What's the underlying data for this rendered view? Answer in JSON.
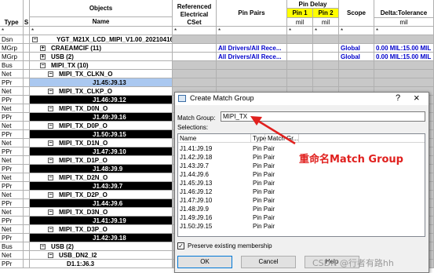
{
  "columns": {
    "type": "Type",
    "s": "S",
    "objects": "Objects",
    "name": "Name",
    "referenced_cset": "Referenced Electrical CSet",
    "pin_pairs": "Pin Pairs",
    "pin_delay": "Pin Delay",
    "pin1": "Pin 1",
    "pin2": "Pin 2",
    "mil1": "mil",
    "mil2": "mil",
    "scope": "Scope",
    "delta_tolerance": "Delta:Tolerance",
    "delta_unit": "mil",
    "star": "*"
  },
  "rows": [
    {
      "type": "Dsn",
      "name": "YGT_M21X_LCD_MIPI_V1.00_20210416-17",
      "toggle": "−",
      "indent": 0,
      "style": "bold",
      "pin_pairs": "",
      "scope": "",
      "delta": ""
    },
    {
      "type": "MGrp",
      "name": "CRAEAMCIF (11)",
      "toggle": "+",
      "indent": 1,
      "style": "bold",
      "pin_pairs": "All Drivers/All Rece...",
      "scope": "Global",
      "delta": "0.00 MIL:15.00 MIL"
    },
    {
      "type": "MGrp",
      "name": "USB (2)",
      "toggle": "+",
      "indent": 1,
      "style": "bold",
      "pin_pairs": "All Drivers/All Rece...",
      "scope": "Global",
      "delta": "0.00 MIL:15.00 MIL"
    },
    {
      "type": "Bus",
      "name": "MIPI_TX (10)",
      "toggle": "−",
      "indent": 1,
      "style": "bold",
      "pin_pairs": "",
      "scope": "",
      "delta": ""
    },
    {
      "type": "Net",
      "name": "MIPI_TX_CLKN_O",
      "toggle": "−",
      "indent": 2,
      "style": "bold",
      "pin_pairs": "",
      "scope": "",
      "delta": ""
    },
    {
      "type": "PPr",
      "name": "J1.45:J9.13",
      "toggle": "",
      "indent": 3,
      "style": "selected",
      "pin_pairs": "",
      "scope": "",
      "delta": ""
    },
    {
      "type": "Net",
      "name": "MIPI_TX_CLKP_O",
      "toggle": "−",
      "indent": 2,
      "style": "bold",
      "pin_pairs": "",
      "scope": "",
      "delta": ""
    },
    {
      "type": "PPr",
      "name": "J1.46:J9.12",
      "toggle": "",
      "indent": 3,
      "style": "dark",
      "pin_pairs": "",
      "scope": "",
      "delta": ""
    },
    {
      "type": "Net",
      "name": "MIPI_TX_D0N_O",
      "toggle": "−",
      "indent": 2,
      "style": "bold",
      "pin_pairs": "",
      "scope": "",
      "delta": ""
    },
    {
      "type": "PPr",
      "name": "J1.49:J9.16",
      "toggle": "",
      "indent": 3,
      "style": "dark",
      "pin_pairs": "",
      "scope": "",
      "delta": ""
    },
    {
      "type": "Net",
      "name": "MIPI_TX_D0P_O",
      "toggle": "−",
      "indent": 2,
      "style": "bold",
      "pin_pairs": "",
      "scope": "",
      "delta": ""
    },
    {
      "type": "PPr",
      "name": "J1.50:J9.15",
      "toggle": "",
      "indent": 3,
      "style": "dark",
      "pin_pairs": "",
      "scope": "",
      "delta": ""
    },
    {
      "type": "Net",
      "name": "MIPI_TX_D1N_O",
      "toggle": "−",
      "indent": 2,
      "style": "bold",
      "pin_pairs": "",
      "scope": "",
      "delta": ""
    },
    {
      "type": "PPr",
      "name": "J1.47:J9.10",
      "toggle": "",
      "indent": 3,
      "style": "dark",
      "pin_pairs": "",
      "scope": "",
      "delta": ""
    },
    {
      "type": "Net",
      "name": "MIPI_TX_D1P_O",
      "toggle": "−",
      "indent": 2,
      "style": "bold",
      "pin_pairs": "",
      "scope": "",
      "delta": ""
    },
    {
      "type": "PPr",
      "name": "J1.48:J9.9",
      "toggle": "",
      "indent": 3,
      "style": "dark",
      "pin_pairs": "",
      "scope": "",
      "delta": ""
    },
    {
      "type": "Net",
      "name": "MIPI_TX_D2N_O",
      "toggle": "−",
      "indent": 2,
      "style": "bold",
      "pin_pairs": "",
      "scope": "",
      "delta": ""
    },
    {
      "type": "PPr",
      "name": "J1.43:J9.7",
      "toggle": "",
      "indent": 3,
      "style": "dark",
      "pin_pairs": "",
      "scope": "",
      "delta": ""
    },
    {
      "type": "Net",
      "name": "MIPI_TX_D2P_O",
      "toggle": "−",
      "indent": 2,
      "style": "bold",
      "pin_pairs": "",
      "scope": "",
      "delta": ""
    },
    {
      "type": "PPr",
      "name": "J1.44:J9.6",
      "toggle": "",
      "indent": 3,
      "style": "dark",
      "pin_pairs": "",
      "scope": "",
      "delta": ""
    },
    {
      "type": "Net",
      "name": "MIPI_TX_D3N_O",
      "toggle": "−",
      "indent": 2,
      "style": "bold",
      "pin_pairs": "",
      "scope": "",
      "delta": ""
    },
    {
      "type": "PPr",
      "name": "J1.41:J9.19",
      "toggle": "",
      "indent": 3,
      "style": "dark",
      "pin_pairs": "",
      "scope": "",
      "delta": ""
    },
    {
      "type": "Net",
      "name": "MIPI_TX_D3P_O",
      "toggle": "−",
      "indent": 2,
      "style": "bold",
      "pin_pairs": "",
      "scope": "",
      "delta": ""
    },
    {
      "type": "PPr",
      "name": "J1.42:J9.18",
      "toggle": "",
      "indent": 3,
      "style": "dark",
      "pin_pairs": "",
      "scope": "",
      "delta": ""
    },
    {
      "type": "Bus",
      "name": "USB (2)",
      "toggle": "−",
      "indent": 1,
      "style": "bold",
      "pin_pairs": "",
      "scope": "",
      "delta": ""
    },
    {
      "type": "Net",
      "name": "USB_DN2_I2",
      "toggle": "−",
      "indent": 2,
      "style": "bold",
      "pin_pairs": "",
      "scope": "",
      "delta": ""
    },
    {
      "type": "PPr",
      "name": "D1.1:J6.3",
      "toggle": "",
      "indent": 3,
      "style": "normal",
      "pin_pairs": "",
      "scope": "",
      "delta": ""
    }
  ],
  "dialog": {
    "title": "Create Match Group",
    "help_glyph": "?",
    "close_glyph": "×",
    "match_group_label": "Match Group:",
    "match_group_value": "MIPI_TX",
    "selections_label": "Selections:",
    "list_headers": {
      "name": "Name",
      "type": "Type",
      "match_group": "Match Gr..."
    },
    "items": [
      {
        "name": "J1.41:J9.19",
        "type": "Pin Pair"
      },
      {
        "name": "J1.42:J9.18",
        "type": "Pin Pair"
      },
      {
        "name": "J1.43:J9.7",
        "type": "Pin Pair"
      },
      {
        "name": "J1.44:J9.6",
        "type": "Pin Pair"
      },
      {
        "name": "J1.45:J9.13",
        "type": "Pin Pair"
      },
      {
        "name": "J1.46:J9.12",
        "type": "Pin Pair"
      },
      {
        "name": "J1.47:J9.10",
        "type": "Pin Pair"
      },
      {
        "name": "J1.48:J9.9",
        "type": "Pin Pair"
      },
      {
        "name": "J1.49:J9.16",
        "type": "Pin Pair"
      },
      {
        "name": "J1.50:J9.15",
        "type": "Pin Pair"
      }
    ],
    "checkbox_label": "Preserve existing membership",
    "checkbox_checked": true,
    "ok_label": "OK",
    "cancel_label": "Cancel",
    "help_label": "Help"
  },
  "annotation": {
    "text": "重命名Match Group",
    "color": "#e0201e"
  },
  "watermark": "CSDN @行者有路hh"
}
